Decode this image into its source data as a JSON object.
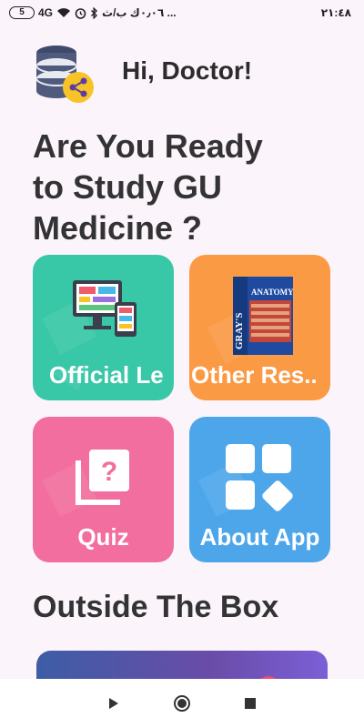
{
  "status_bar": {
    "battery": "5",
    "network": "4G",
    "network_sub": "↑↓",
    "speed": "٠٫٠٦ك ب/ث ...",
    "time": "٢١:٤٨"
  },
  "header": {
    "greeting": "Hi, Doctor!",
    "avatar_icon": "database-share-icon"
  },
  "headline": {
    "line1": "Are You Ready",
    "line2": "to Study GU",
    "line3": "Medicine ?"
  },
  "cards": [
    {
      "label": "Official Le",
      "icon": "computer-devices-icon",
      "color": "#38c7a7"
    },
    {
      "label": "Other Res..",
      "icon": "grays-anatomy-book-icon",
      "color": "#fb9a45"
    },
    {
      "label": "Quiz",
      "icon": "quiz-question-icon",
      "color": "#f26e9e"
    },
    {
      "label": "About App",
      "icon": "apps-grid-icon",
      "color": "#4ea6ea"
    }
  ],
  "section": {
    "title": "Outside The Box"
  },
  "book": {
    "spine": "GRAY'S",
    "title": "ANATOMY"
  },
  "navbar": {
    "back_icon": "back-triangle-icon",
    "home_icon": "home-circle-icon",
    "recents_icon": "recents-square-icon"
  }
}
